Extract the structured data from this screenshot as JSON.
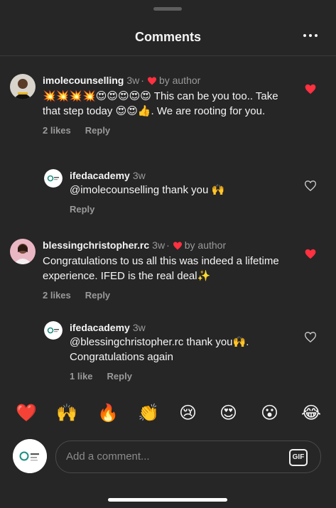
{
  "header": {
    "title": "Comments"
  },
  "comments": [
    {
      "username": "imolecounselling",
      "time": "3w",
      "badge": "by author",
      "text": "💥💥💥💥😍😍😍😍😍 This can be you too.. Take that step today 😍😍👍. We are rooting for you.",
      "likes": "2 likes",
      "reply": "Reply",
      "liked": true
    },
    {
      "username": "ifedacademy",
      "time": "3w",
      "text": "@imolecounselling thank you 🙌",
      "reply": "Reply",
      "liked": false
    },
    {
      "username": "blessingchristopher.rc",
      "time": "3w",
      "badge": "by author",
      "text": "Congratulations to us all this was indeed a lifetime experience.  IFED is the real deal✨",
      "likes": "2 likes",
      "reply": "Reply",
      "liked": true
    },
    {
      "username": "ifedacademy",
      "time": "3w",
      "text": "@blessingchristopher.rc thank you🙌. Congratulations again",
      "likes": "1 like",
      "reply": "Reply",
      "liked": false
    }
  ],
  "quick_reactions": [
    "❤️",
    "🙌",
    "🔥",
    "👏",
    "😢",
    "😍",
    "😮",
    "😂"
  ],
  "composer": {
    "placeholder": "Add a comment...",
    "gif_label": "GIF"
  },
  "colors": {
    "background": "#262626",
    "like_red": "#ff3040",
    "muted": "#9a9a9a"
  }
}
